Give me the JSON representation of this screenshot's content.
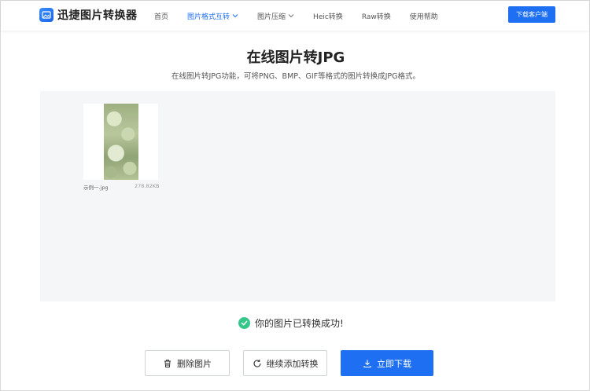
{
  "header": {
    "logo_text": "迅捷图片转换器",
    "nav": [
      {
        "label": "首页",
        "active": false,
        "dropdown": false
      },
      {
        "label": "图片格式互转",
        "active": true,
        "dropdown": true
      },
      {
        "label": "图片压缩",
        "active": false,
        "dropdown": true
      },
      {
        "label": "Heic转换",
        "active": false,
        "dropdown": false
      },
      {
        "label": "Raw转换",
        "active": false,
        "dropdown": false
      },
      {
        "label": "使用帮助",
        "active": false,
        "dropdown": false
      }
    ],
    "download_client_label": "下载客户端"
  },
  "main": {
    "title": "在线图片转JPG",
    "subtitle": "在线图片转JPG功能，可将PNG、BMP、GIF等格式的图片转换成JPG格式。",
    "files": [
      {
        "name": "示例一.jpg",
        "size": "278.82KB"
      }
    ],
    "success_text": "你的图片已转换成功!"
  },
  "actions": {
    "delete_label": "删除图片",
    "continue_label": "继续添加转换",
    "download_label": "立即下载"
  },
  "colors": {
    "accent": "#1e6ff1",
    "success": "#35c78a",
    "drop_area_bg": "#f5f6f8"
  }
}
